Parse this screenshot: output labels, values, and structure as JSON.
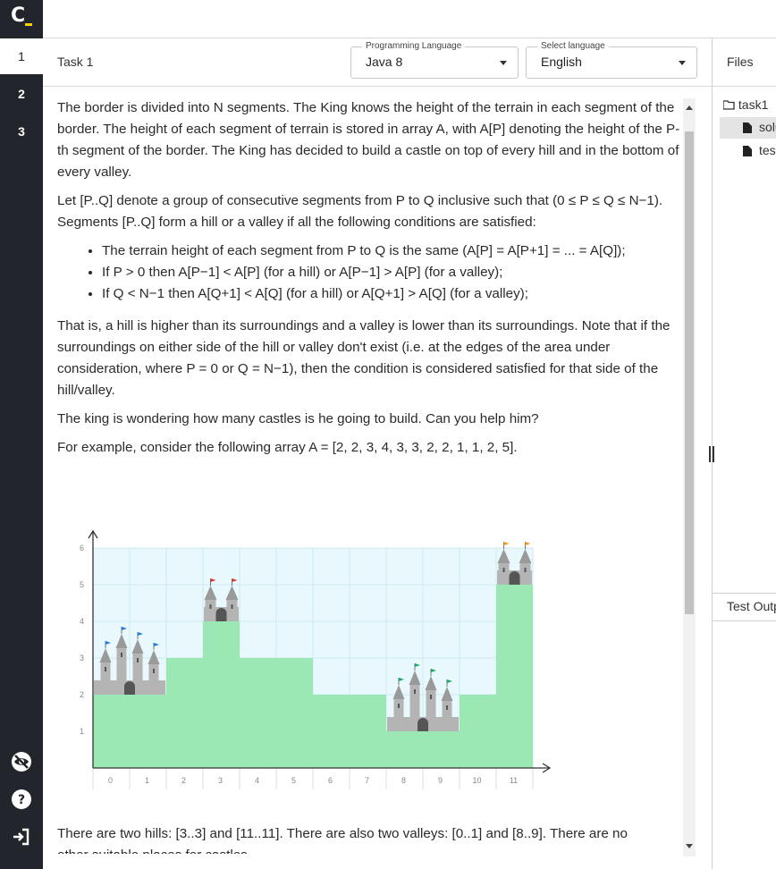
{
  "logo": {
    "letter": "C"
  },
  "tasks": [
    {
      "label": "1",
      "active": true
    },
    {
      "label": "2",
      "active": false
    },
    {
      "label": "3",
      "active": false
    }
  ],
  "task_title": "Task 1",
  "programming_language": {
    "label": "Programming Language",
    "value": "Java 8"
  },
  "select_language": {
    "label": "Select language",
    "value": "English"
  },
  "description": {
    "p1": "The border is divided into N segments. The King knows the height of the terrain in each segment of the border. The height of each segment of terrain is stored in array A, with A[P] denoting the height of the P-th segment of the border. The King has decided to build a castle on top of every hill and in the bottom of every valley.",
    "p2": "Let [P..Q] denote a group of consecutive segments from P to Q inclusive such that (0 ≤ P ≤ Q ≤ N−1). Segments [P..Q] form a hill or a valley if all the following conditions are satisfied:",
    "bullets": [
      "The terrain height of each segment from P to Q is the same (A[P] = A[P+1] = ... = A[Q]);",
      "If P > 0 then A[P−1] < A[P] (for a hill) or A[P−1] > A[P] (for a valley);",
      "If Q < N−1 then A[Q+1] < A[Q] (for a hill) or A[Q+1] > A[Q] (for a valley);"
    ],
    "p3": "That is, a hill is higher than its surroundings and a valley is lower than its surroundings. Note that if the surroundings on either side of the hill or valley don't exist (i.e. at the edges of the area under consideration, where P = 0 or Q = N−1), then the condition is considered satisfied for that side of the hill/valley.",
    "p4": "The king is wondering how many castles is he going to build. Can you help him?",
    "p5": "For example, consider the following array A = [2, 2, 3, 4, 3, 3, 2, 2, 1, 1, 2, 5].",
    "p6": "There are two hills: [3..3] and [11..11]. There are also two valleys: [0..1] and [8..9]. There are no",
    "p7": "other suitable places for castles."
  },
  "files_panel": {
    "title": "Files",
    "folder": "task1",
    "files": [
      "solution.java",
      "test-input.txt"
    ]
  },
  "test_output_label": "Test Output",
  "chart_data": {
    "type": "bar",
    "categories": [
      "0",
      "1",
      "2",
      "3",
      "4",
      "5",
      "6",
      "7",
      "8",
      "9",
      "10",
      "11"
    ],
    "values": [
      2,
      2,
      3,
      4,
      3,
      3,
      2,
      2,
      1,
      1,
      2,
      5
    ],
    "title": "",
    "xlabel": "",
    "ylabel": "",
    "ylim": [
      0,
      6
    ],
    "yticks": [
      "1",
      "2",
      "3",
      "4",
      "5",
      "6"
    ],
    "grid": true,
    "castles": [
      {
        "range": [
          0,
          1
        ],
        "kind": "valley",
        "flag_color": "#1e7bd9"
      },
      {
        "range": [
          3,
          3
        ],
        "kind": "hill",
        "flag_color": "#e0342c"
      },
      {
        "range": [
          8,
          9
        ],
        "kind": "valley",
        "flag_color": "#1aa86b"
      },
      {
        "range": [
          11,
          11
        ],
        "kind": "hill",
        "flag_color": "#f39c12"
      }
    ],
    "colors": {
      "bar": "#9be8b4",
      "sky": "#e8f8fc",
      "grid": "#cdeaf0",
      "axis": "#333333",
      "castle": "#b4b4b4"
    }
  }
}
